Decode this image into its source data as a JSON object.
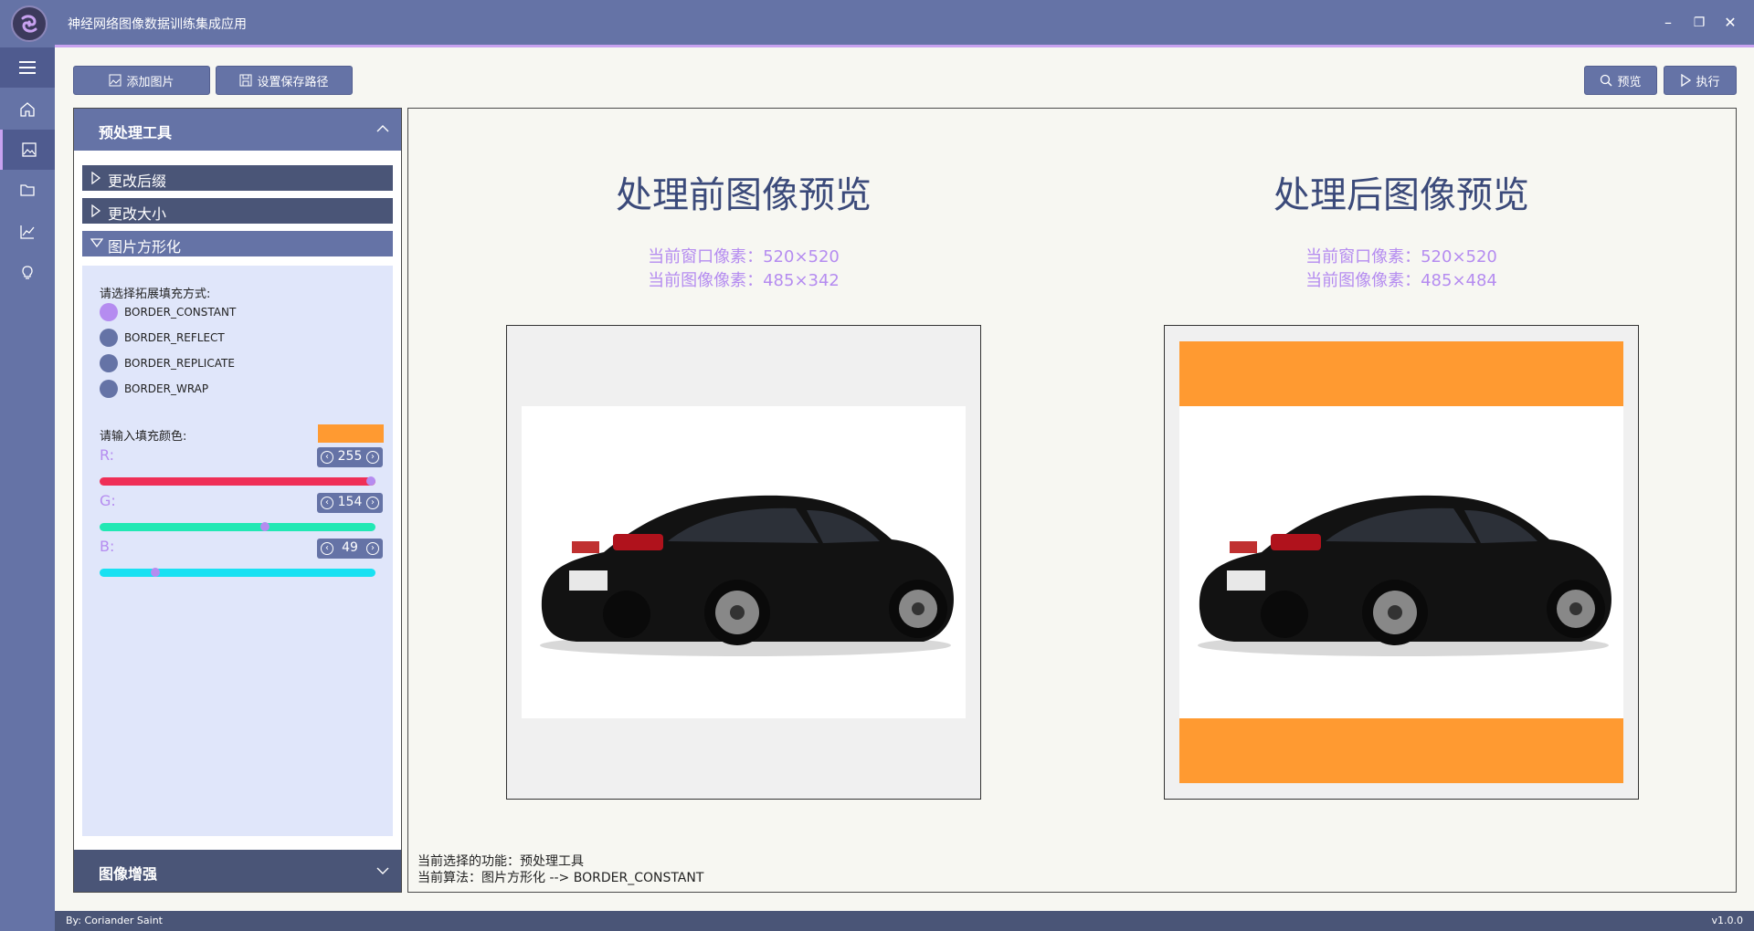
{
  "window": {
    "title": "神经网络图像数据训练集成应用",
    "minimize": "–",
    "maximize": "❐",
    "close": "✕"
  },
  "toolbar": {
    "add_image": "添加图片",
    "set_save_path": "设置保存路径",
    "preview": "预览",
    "execute": "执行"
  },
  "left_panel": {
    "title": "预处理工具",
    "accordion": [
      {
        "label": "更改后缀",
        "expanded": false
      },
      {
        "label": "更改大小",
        "expanded": false
      },
      {
        "label": "图片方形化",
        "expanded": true
      }
    ],
    "fill_mode_prompt": "请选择拓展填充方式:",
    "fill_modes": [
      {
        "label": "BORDER_CONSTANT",
        "selected": true
      },
      {
        "label": "BORDER_REFLECT",
        "selected": false
      },
      {
        "label": "BORDER_REPLICATE",
        "selected": false
      },
      {
        "label": "BORDER_WRAP",
        "selected": false
      }
    ],
    "color_prompt": "请输入填充颜色:",
    "fill_color": "#ff9a31",
    "channels": [
      {
        "label": "R:",
        "value": "255",
        "level": 1.0,
        "track_color": "#ef2f57"
      },
      {
        "label": "G:",
        "value": "154",
        "level": 0.604,
        "track_color": "#22e8b4"
      },
      {
        "label": "B:",
        "value": "49",
        "level": 0.192,
        "track_color": "#19e1f2"
      }
    ],
    "enhance_title": "图像增强"
  },
  "preview": {
    "before": {
      "title": "处理前图像预览",
      "window_px": "当前窗口像素：520×520",
      "image_px": "当前图像像素：485×342"
    },
    "after": {
      "title": "处理后图像预览",
      "window_px": "当前窗口像素：520×520",
      "image_px": "当前图像像素：485×484"
    },
    "status_function": "当前选择的功能：预处理工具",
    "status_algorithm": "当前算法：图片方形化 --> BORDER_CONSTANT"
  },
  "footer": {
    "author": "By: Coriander Saint",
    "version": "v1.0.0"
  },
  "colors": {
    "primary": "#6573a6",
    "primary_dark": "#4a5577",
    "accent": "#b58cf0",
    "panel_bg": "#e0e6fa"
  }
}
